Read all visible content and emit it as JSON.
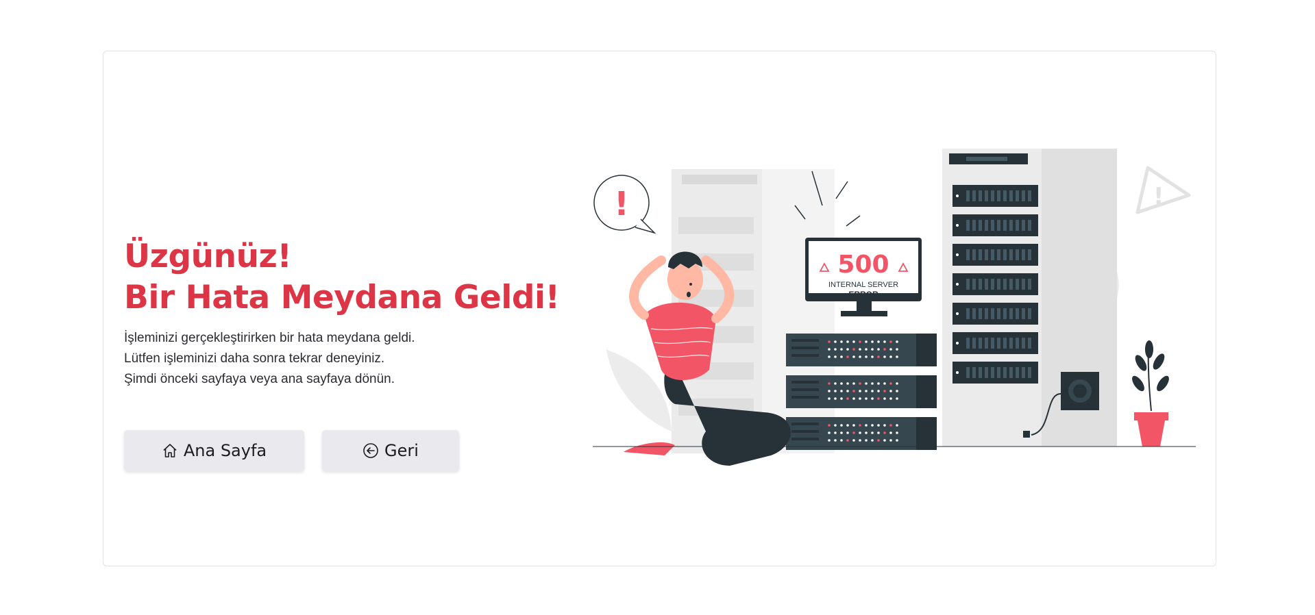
{
  "heading": {
    "line1": "Üzgünüz!",
    "line2": "Bir Hata Meydana Geldi!"
  },
  "description": {
    "line1": "İşleminizi gerçekleştirirken bir hata meydana geldi.",
    "line2": "Lütfen işleminizi daha sonra tekrar deneyiniz.",
    "line3": "Şimdi önceki sayfaya veya ana sayfaya dönün."
  },
  "buttons": {
    "home": {
      "label": "Ana Sayfa",
      "icon": "house-icon"
    },
    "back": {
      "label": "Geri",
      "icon": "arrow-left-circle-icon"
    }
  },
  "illustration": {
    "code": "500",
    "line1": "INTERNAL SERVER",
    "line2": "ERROR",
    "exclamation": "!"
  },
  "colors": {
    "accent": "#dc3545",
    "illustration_red": "#f25565",
    "server_dark": "#263238",
    "button_bg": "#e9e9ee"
  }
}
